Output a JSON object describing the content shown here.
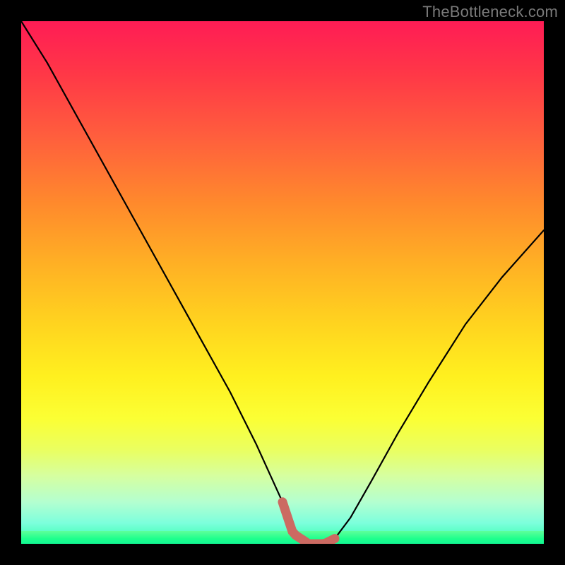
{
  "watermark": "TheBottleneck.com",
  "colors": {
    "frame": "#000000",
    "watermark": "#7a7a7a",
    "curve": "#000000",
    "thick_segment": "#cc6a62"
  },
  "chart_data": {
    "type": "line",
    "title": "",
    "xlabel": "",
    "ylabel": "",
    "xlim": [
      0,
      100
    ],
    "ylim": [
      0,
      100
    ],
    "grid": false,
    "series": [
      {
        "name": "bottleneck-curve",
        "x": [
          0,
          5,
          10,
          15,
          20,
          25,
          30,
          35,
          40,
          45,
          50,
          52,
          55,
          58,
          60,
          63,
          67,
          72,
          78,
          85,
          92,
          100
        ],
        "y": [
          100,
          92,
          83,
          74,
          65,
          56,
          47,
          38,
          29,
          19,
          8,
          2,
          0,
          0,
          1,
          5,
          12,
          21,
          31,
          42,
          51,
          60
        ]
      }
    ],
    "annotations": [
      {
        "name": "recommended-range",
        "x_start": 50,
        "x_end": 60,
        "style": "thick-red-segment"
      }
    ],
    "background_gradient": [
      "#ff1c55",
      "#ff3747",
      "#ff5e3d",
      "#ff8a2c",
      "#ffb224",
      "#ffd41f",
      "#fff01f",
      "#fbff34",
      "#eaff60",
      "#d6ffa0",
      "#b4ffd0",
      "#7dffdc",
      "#2cffa8"
    ]
  }
}
